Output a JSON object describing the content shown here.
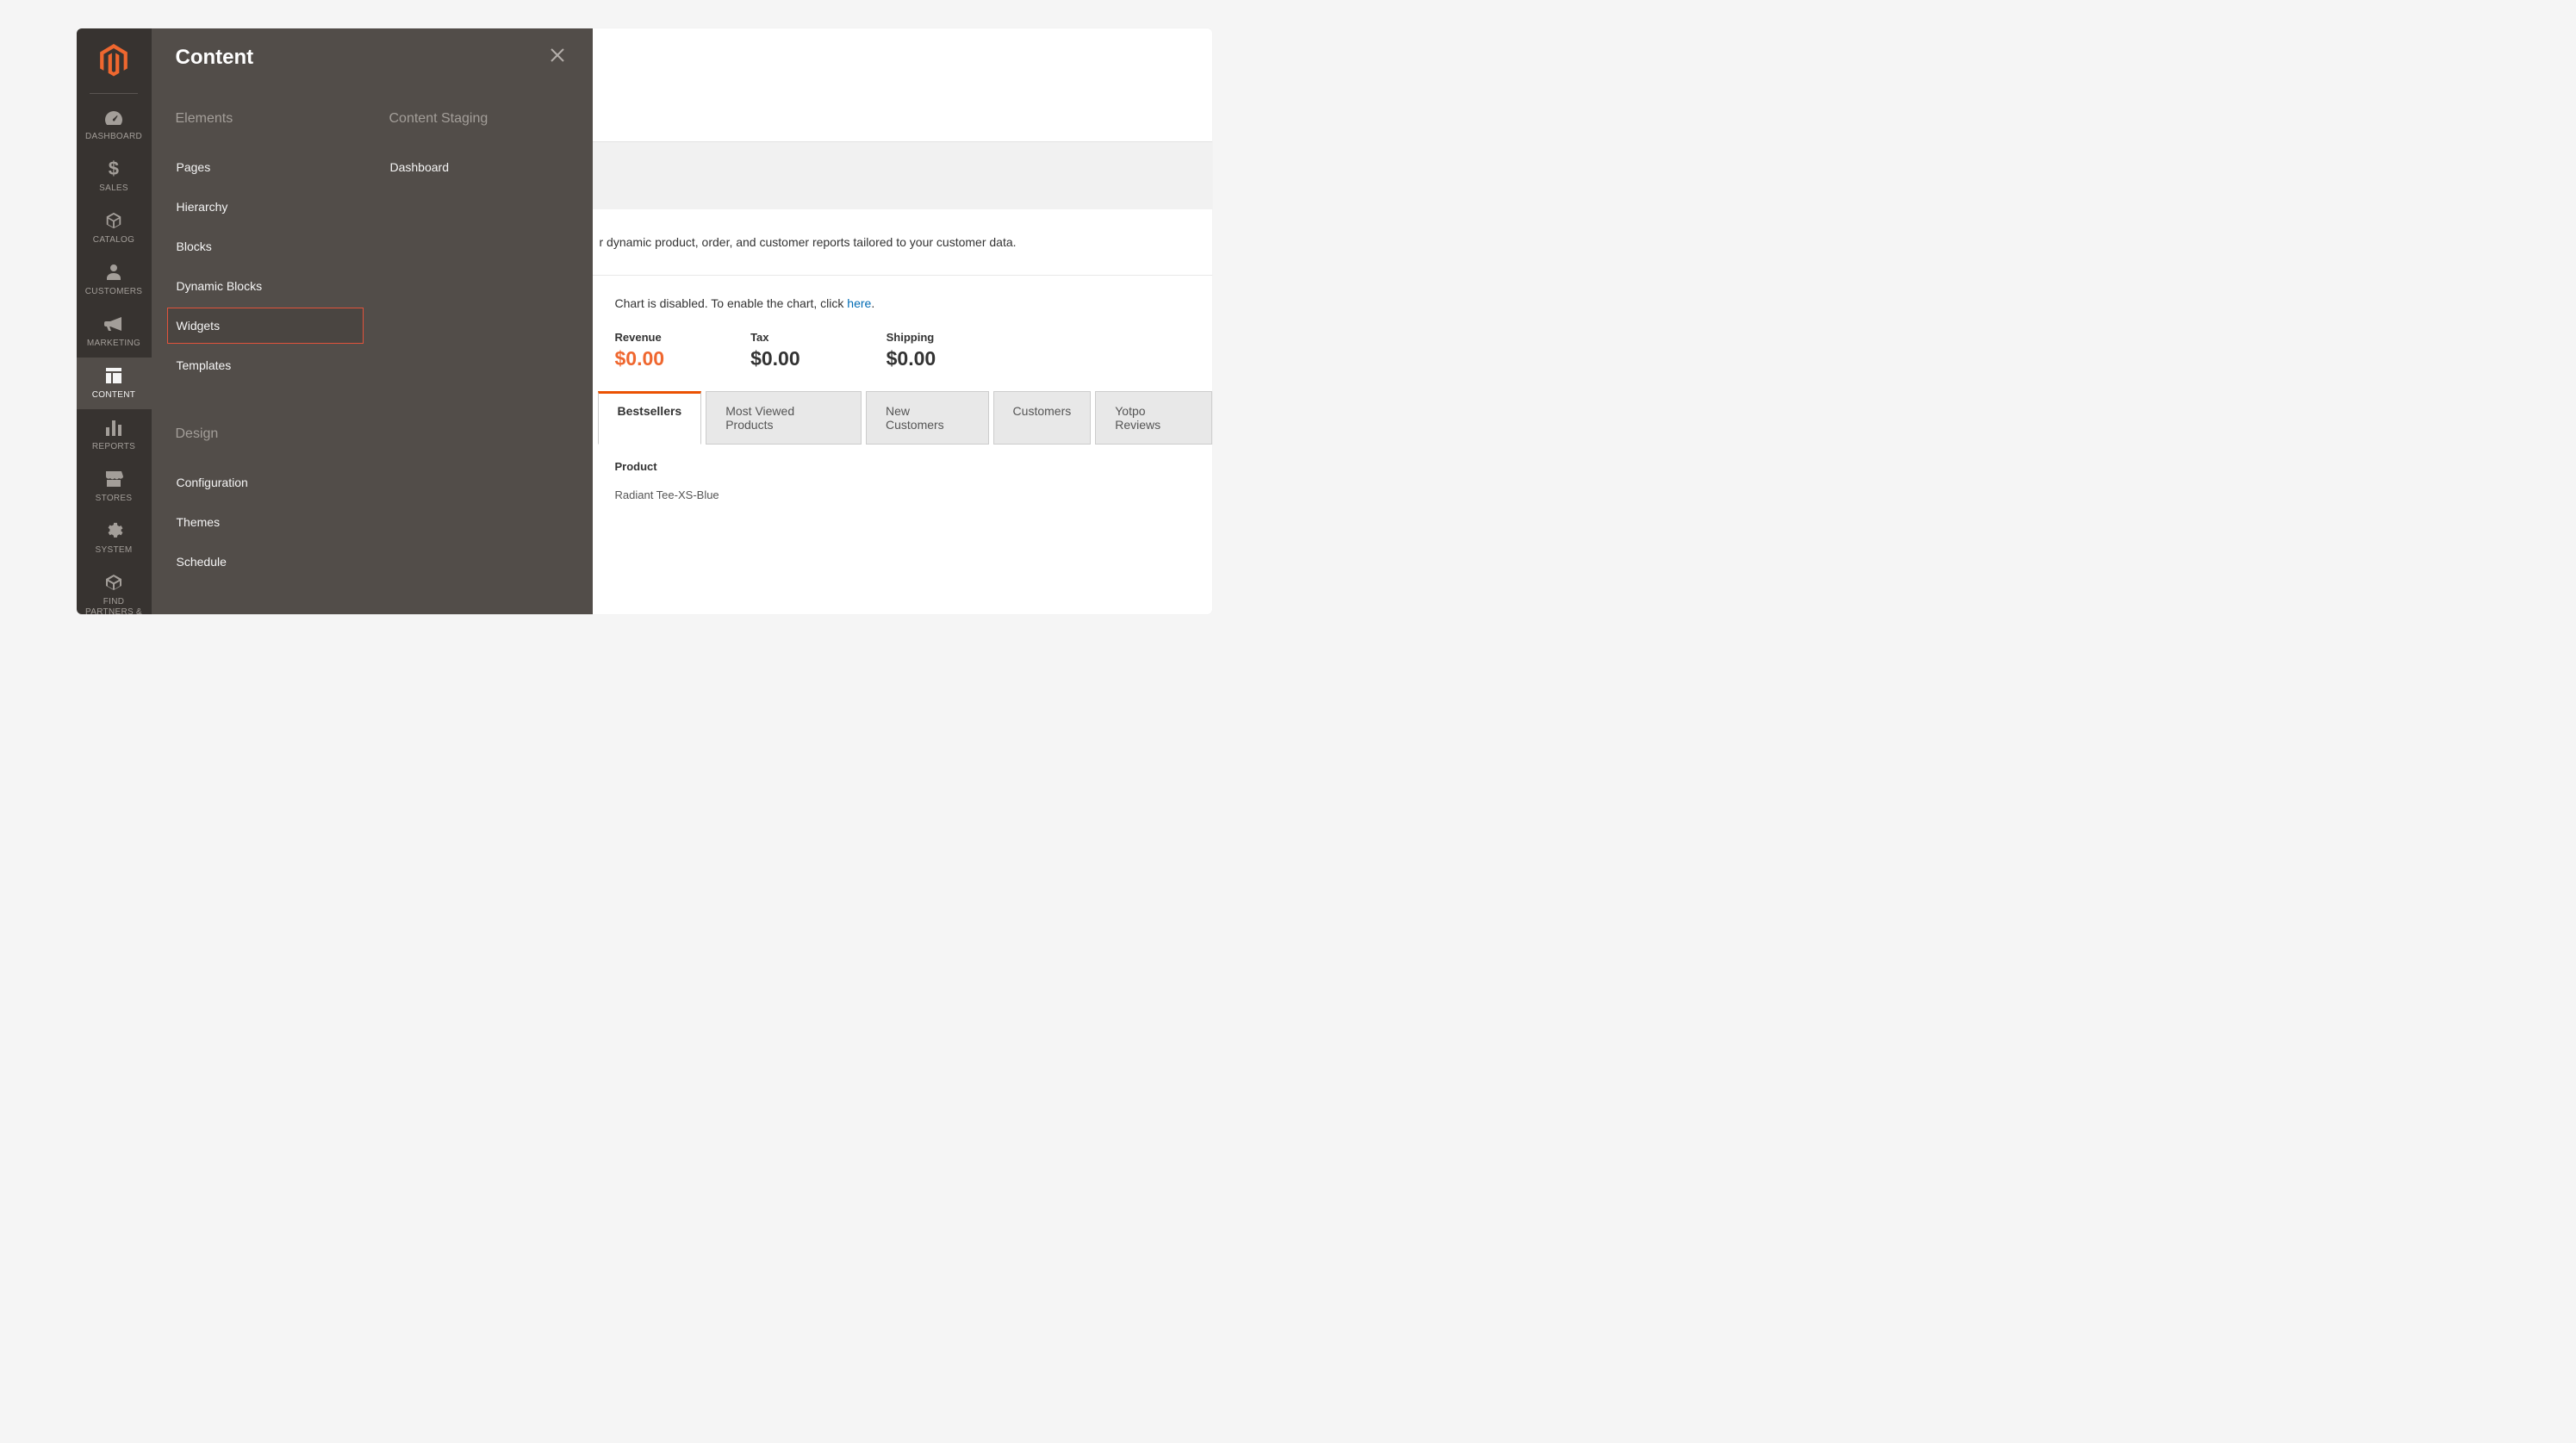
{
  "flyout": {
    "title": "Content",
    "groups": {
      "elements": {
        "heading": "Elements",
        "items": {
          "pages": "Pages",
          "hierarchy": "Hierarchy",
          "blocks": "Blocks",
          "dynamic_blocks": "Dynamic Blocks",
          "widgets": "Widgets",
          "templates": "Templates"
        }
      },
      "design": {
        "heading": "Design",
        "items": {
          "configuration": "Configuration",
          "themes": "Themes",
          "schedule": "Schedule"
        }
      },
      "content_staging": {
        "heading": "Content Staging",
        "items": {
          "dashboard": "Dashboard"
        }
      }
    }
  },
  "sidebar": {
    "dashboard": "DASHBOARD",
    "sales": "SALES",
    "catalog": "CATALOG",
    "customers": "CUSTOMERS",
    "marketing": "MARKETING",
    "content": "CONTENT",
    "reports": "REPORTS",
    "stores": "STORES",
    "system": "SYSTEM",
    "partners": "FIND PARTNERS & EXTENSIONS"
  },
  "main": {
    "description_fragment": "r dynamic product, order, and customer reports tailored to your customer data.",
    "chart_msg_prefix": "Chart is disabled. To enable the chart, click ",
    "chart_msg_link": "here",
    "chart_msg_suffix": ".",
    "stats": {
      "revenue": {
        "label": "Revenue",
        "value": "$0.00"
      },
      "tax": {
        "label": "Tax",
        "value": "$0.00"
      },
      "shipping": {
        "label": "Shipping",
        "value": "$0.00"
      }
    },
    "tabs": {
      "bestsellers": "Bestsellers",
      "most_viewed": "Most Viewed Products",
      "new_customers": "New Customers",
      "customers": "Customers",
      "yotpo": "Yotpo Reviews"
    },
    "table": {
      "header_product": "Product",
      "row0_product": "Radiant Tee-XS-Blue"
    }
  }
}
